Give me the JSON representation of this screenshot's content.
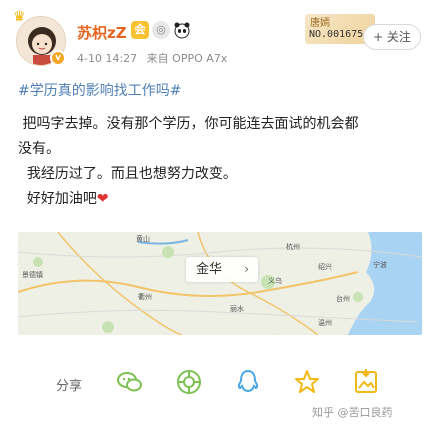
{
  "user": {
    "name": "苏枳zZ",
    "time": "4-10 14:27",
    "source": "来自 OPPO A7x",
    "card_name": "唐嫣",
    "card_no": "NO.001675"
  },
  "follow_label": "+ 关注",
  "post": {
    "topic": "#学历真的影响找工作吗#",
    "line1": " 把吗字去掉。没有那个学历，你可能连去面试的机会都",
    "line2": "没有。",
    "line3": "  我经历过了。而且也想努力改变。",
    "line4": "  好好加油吧"
  },
  "map": {
    "place": "金华",
    "labels": [
      "黄山",
      "景德镇",
      "杭州",
      "宁波",
      "衢州",
      "丽水",
      "温州",
      "台州",
      "义乌",
      "绍兴"
    ]
  },
  "share": {
    "label": "分享",
    "icons": [
      "wechat-icon",
      "moments-icon",
      "weibo-icon",
      "qq-icon",
      "qzone-icon",
      "image-icon"
    ]
  },
  "footer": "知乎 @苦口良药",
  "colors": {
    "accent_orange": "#e3651f",
    "link_blue": "#4f7fb4",
    "icon_green": "#7cc152",
    "icon_blue": "#4aa8e4",
    "icon_yellow": "#f2b816"
  }
}
